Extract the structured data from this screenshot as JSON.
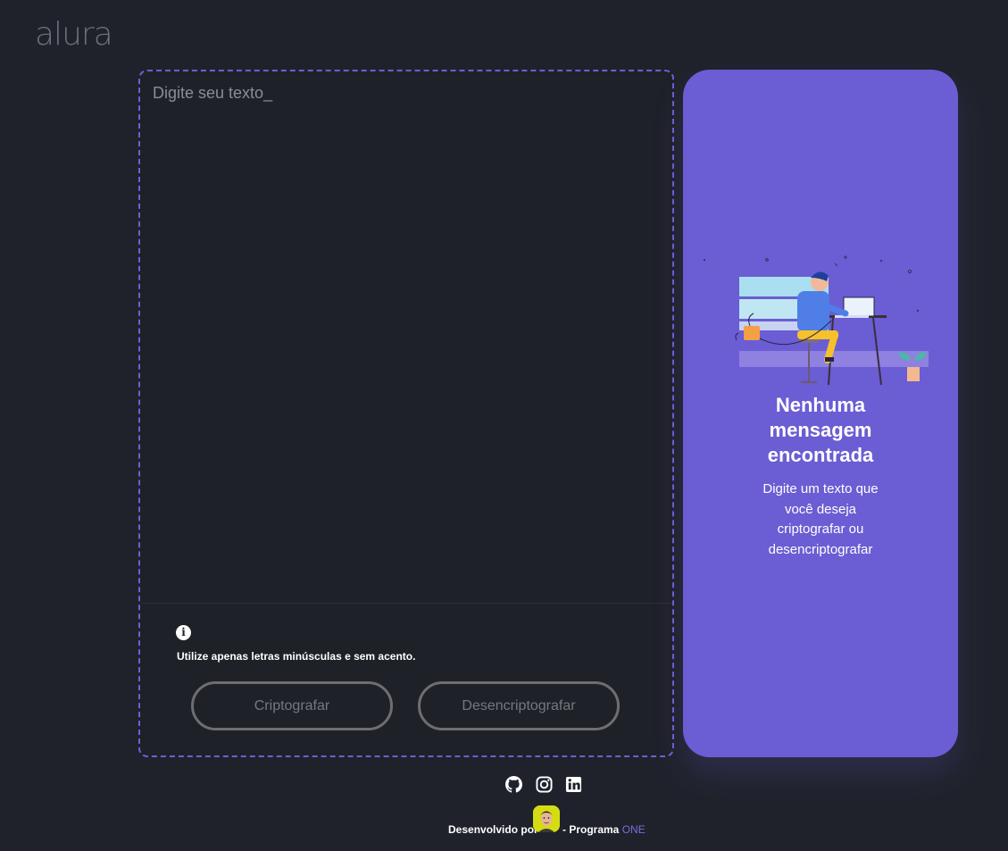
{
  "logo": "alura",
  "input": {
    "placeholder": "Digite seu texto_",
    "value": ""
  },
  "info": {
    "icon": "info-icon",
    "text": "Utilize apenas letras minúsculas e sem acento."
  },
  "buttons": {
    "encrypt": "Criptografar",
    "decrypt": "Desencriptografar"
  },
  "output": {
    "title_lines": [
      "Nenhuma",
      "mensagem",
      "encontrada"
    ],
    "subtitle_lines": [
      "Digite um texto que",
      "você deseja",
      "criptografar ou",
      "desencriptografar"
    ]
  },
  "socials": [
    "github-icon",
    "instagram-icon",
    "linkedin-icon"
  ],
  "footer": {
    "prefix": "Desenvolvido por",
    "middle": "- Programa",
    "program": "ONE"
  },
  "colors": {
    "background": "#20222b",
    "accent": "#6b5dd3",
    "avatar_bg": "#d4dd12"
  }
}
